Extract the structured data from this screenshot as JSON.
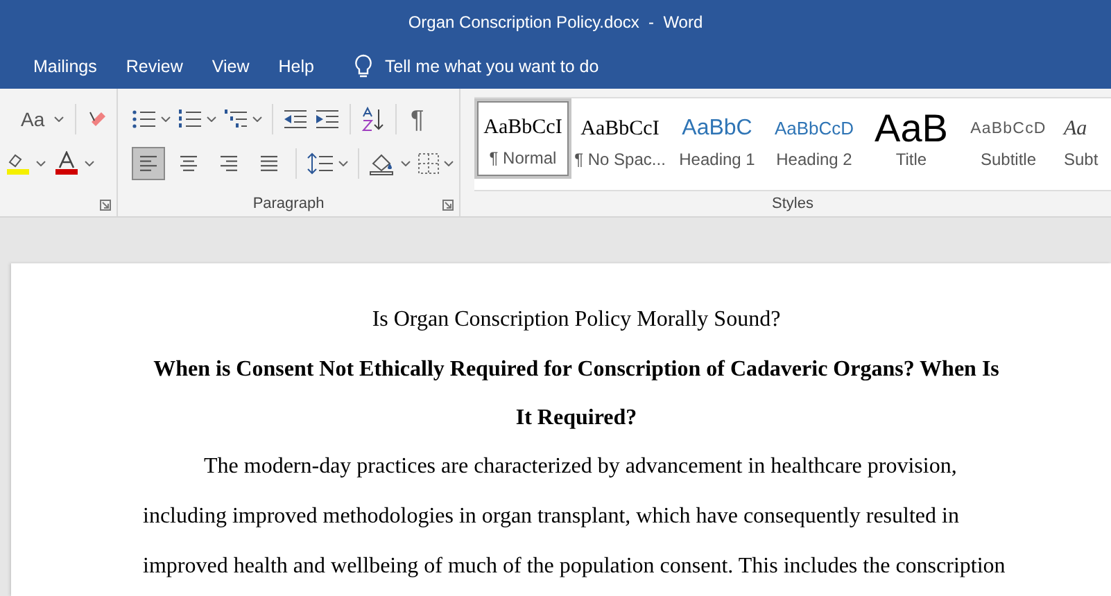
{
  "window": {
    "title": "Organ Conscription Policy.docx  -  Word"
  },
  "menu": [
    {
      "label": "Mailings"
    },
    {
      "label": "Review"
    },
    {
      "label": "View"
    },
    {
      "label": "Help"
    }
  ],
  "tell_me": {
    "placeholder": "Tell me what you want to do"
  },
  "font_group": {
    "change_case": "Aa"
  },
  "paragraph_group": {
    "label": "Paragraph",
    "show_marks": "¶",
    "alignment": [
      {
        "kind": "left",
        "selected": true
      },
      {
        "kind": "center",
        "selected": false
      },
      {
        "kind": "right",
        "selected": false
      },
      {
        "kind": "justify",
        "selected": false
      }
    ]
  },
  "styles_group": {
    "label": "Styles",
    "styles": [
      {
        "preview": "AaBbCcI",
        "name": "¶ Normal",
        "kind": "normal",
        "selected": true
      },
      {
        "preview": "AaBbCcI",
        "name": "¶ No Spac...",
        "kind": "normal",
        "selected": false
      },
      {
        "preview": "AaBbC",
        "name": "Heading 1",
        "kind": "heading1",
        "selected": false
      },
      {
        "preview": "AaBbCcD",
        "name": "Heading 2",
        "kind": "heading2",
        "selected": false
      },
      {
        "preview": "AaB",
        "name": "Title",
        "kind": "title",
        "selected": false
      },
      {
        "preview": "AaBbCcD",
        "name": "Subtitle",
        "kind": "subtitle",
        "selected": false
      },
      {
        "preview": "Aa",
        "name": "Subt",
        "kind": "emphasis",
        "selected": false
      }
    ]
  },
  "document": {
    "title": "Is Organ Conscription Policy Morally Sound?",
    "heading": "When is Consent Not Ethically Required for Conscription of Cadaveric Organs? When Is It Required?",
    "body": "The modern-day practices are characterized by advancement in healthcare provision, including improved methodologies in organ transplant, which have consequently resulted in improved health and wellbeing of much of the population consent. This includes the conscription"
  }
}
